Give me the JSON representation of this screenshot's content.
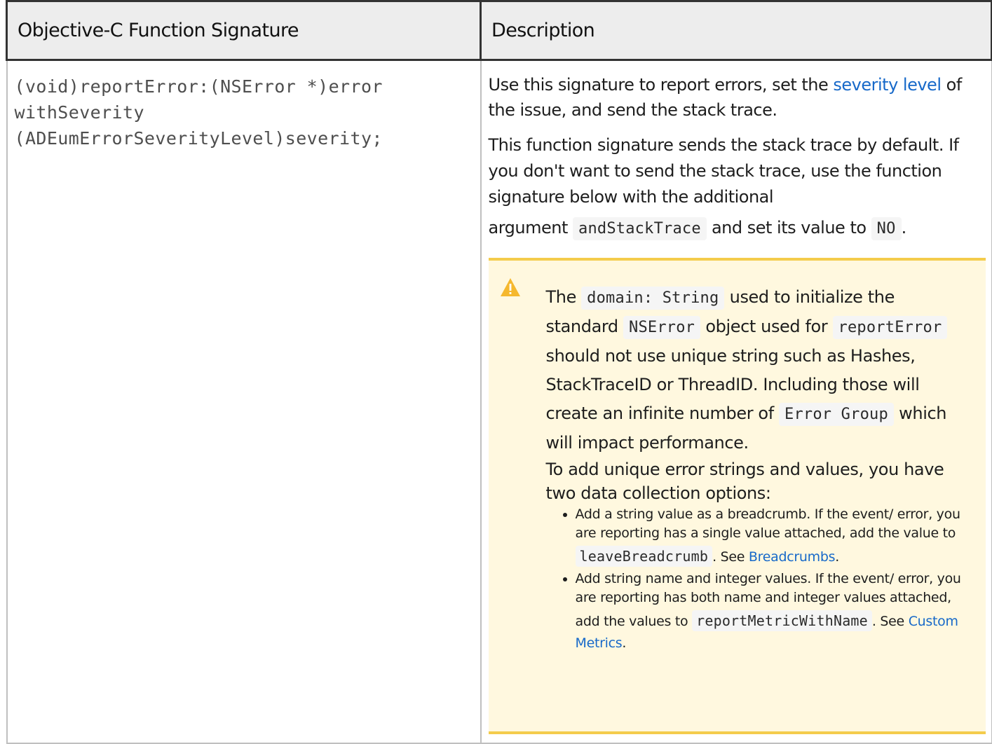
{
  "table": {
    "headers": {
      "signature": "Objective-C Function Signature",
      "description": "Description"
    },
    "row": {
      "signature_code": "(void)reportError:(NSError *)error\nwithSeverity\n(ADEumErrorSeverityLevel)severity;",
      "p1": {
        "before": "Use this signature to report errors, set the ",
        "link": "severity level",
        "after": " of the issue, and send the stack trace."
      },
      "p2": {
        "text": "This function signature sends the stack trace by default. If you don't want to send the stack trace, use the function signature below with the additional",
        "argument_word": "argument",
        "code1": "andStackTrace",
        "mid": "and set its value to",
        "code2": "NO",
        "end": "."
      },
      "warning": {
        "icon": "warning-triangle-icon",
        "t1": "The",
        "c1": "domain: String",
        "t2": "used to initialize the standard",
        "c2": "NSError",
        "t3": "object used for",
        "c3": "reportError",
        "t4": "should not use unique string such as Hashes, StackTraceID or ThreadID. Including those will create an infinite number of",
        "c4": "Error Group",
        "t5": "which will impact performance.",
        "t6": "To add unique error strings and values, you have two data collection options:",
        "items": [
          {
            "text": "Add a string value as a breadcrumb. If the event/ error, you are reporting has a single value attached, add the value to",
            "code": "leaveBreadcrumb",
            "see": ". See",
            "link": "Breadcrumbs",
            "end": "."
          },
          {
            "text": "Add string name and integer values. If the event/ error, you are reporting has both name and integer values attached, add the values to",
            "code": "reportMetricWithName",
            "see": ". See",
            "link": "Custom Metrics",
            "end": "."
          }
        ]
      }
    }
  },
  "colors": {
    "link": "#1769c9",
    "warning_bg": "#fff8df",
    "warning_border": "#f4cc4c",
    "header_bg": "#ededed"
  }
}
